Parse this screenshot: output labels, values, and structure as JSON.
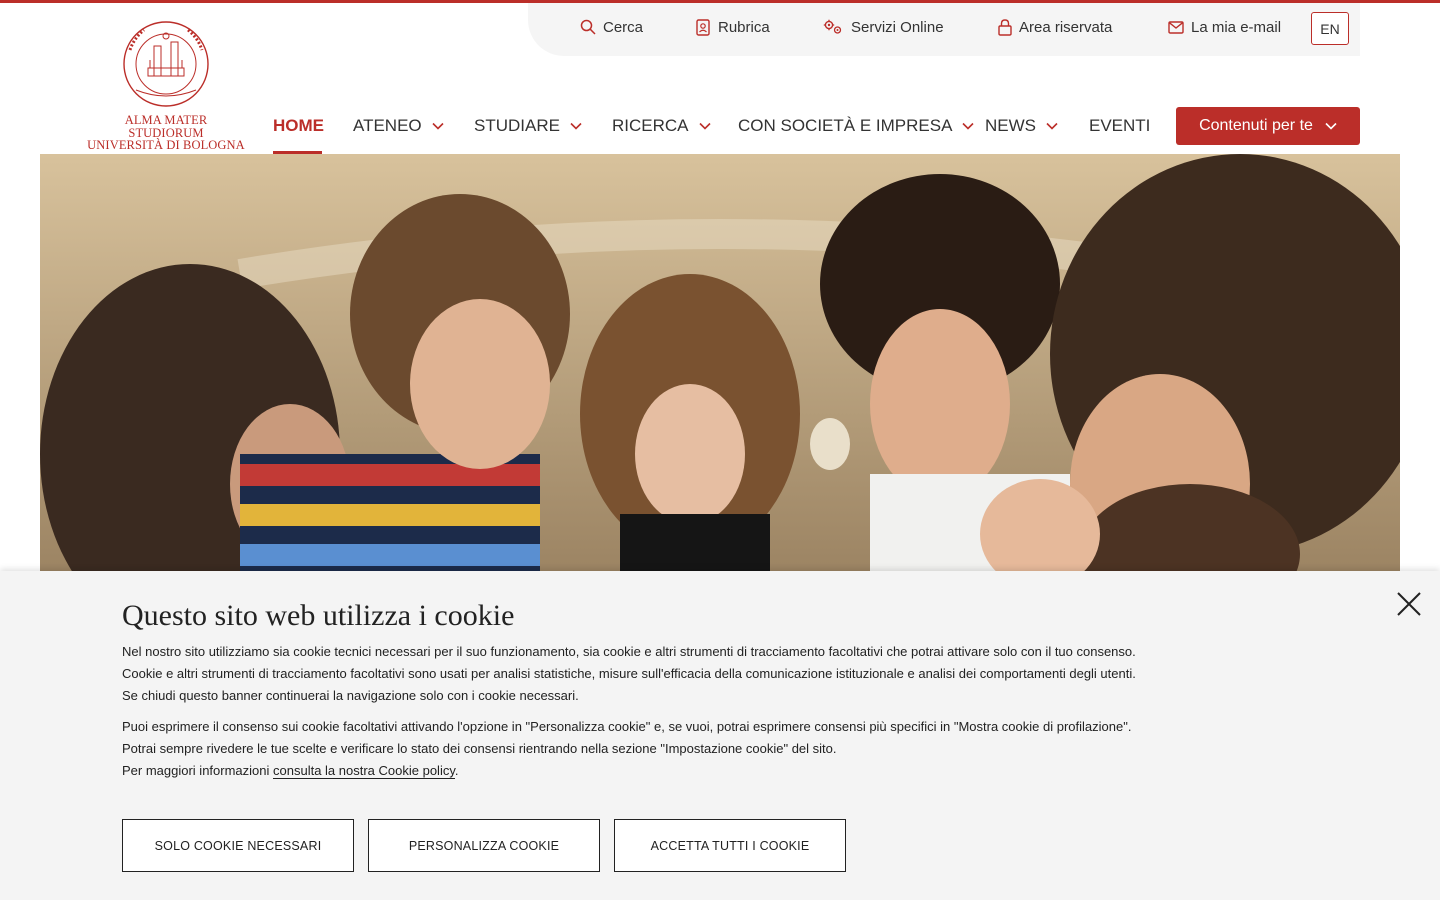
{
  "logo": {
    "line1": "ALMA MATER STUDIORUM",
    "line2": "UNIVERSITÀ DI BOLOGNA",
    "seal_text": "ALMA MATER STUDIORUM · UNIVERSITÀ DI BOLOGNA · A.D. 1088"
  },
  "utility": {
    "search": "Cerca",
    "directory": "Rubrica",
    "online_services": "Servizi Online",
    "reserved_area": "Area riservata",
    "email": "La mia e-mail",
    "lang": "EN"
  },
  "nav": {
    "home": "HOME",
    "ateneo": "ATENEO",
    "studiare": "STUDIARE",
    "ricerca": "RICERCA",
    "societa": "CON SOCIETÀ E IMPRESA",
    "news": "NEWS",
    "eventi": "EVENTI",
    "cta": "Contenuti per te"
  },
  "cookie": {
    "title": "Questo sito web utilizza i cookie",
    "p1_l1": "Nel nostro sito utilizziamo sia cookie tecnici necessari per il suo funzionamento, sia cookie e altri strumenti di tracciamento facoltativi che potrai attivare solo con il tuo consenso.",
    "p1_l2": "Cookie e altri strumenti di tracciamento facoltativi sono usati per analisi statistiche, misure sull'efficacia della comunicazione istituzionale e analisi dei comportamenti degli utenti.",
    "p1_l3": "Se chiudi questo banner continuerai la navigazione solo con i cookie necessari.",
    "p2_l1": "Puoi esprimere il consenso sui cookie facoltativi attivando l'opzione in \"Personalizza cookie\" e, se vuoi, potrai esprimere consensi più specifici in \"Mostra cookie di profilazione\".",
    "p2_l2": "Potrai sempre rivedere le tue scelte e verificare lo stato dei consensi rientrando nella sezione \"Impostazione cookie\" del sito.",
    "p2_l3_prefix": "Per maggiori informazioni ",
    "p2_link": "consulta la nostra Cookie policy",
    "p2_suffix": ".",
    "btn_necessary": "SOLO COOKIE NECESSARI",
    "btn_customize": "PERSONALIZZA COOKIE",
    "btn_accept": "ACCETTA TUTTI I COOKIE"
  },
  "colors": {
    "brand": "#bb2e29",
    "banner_bg": "#f4f4f4",
    "text": "#222222"
  }
}
